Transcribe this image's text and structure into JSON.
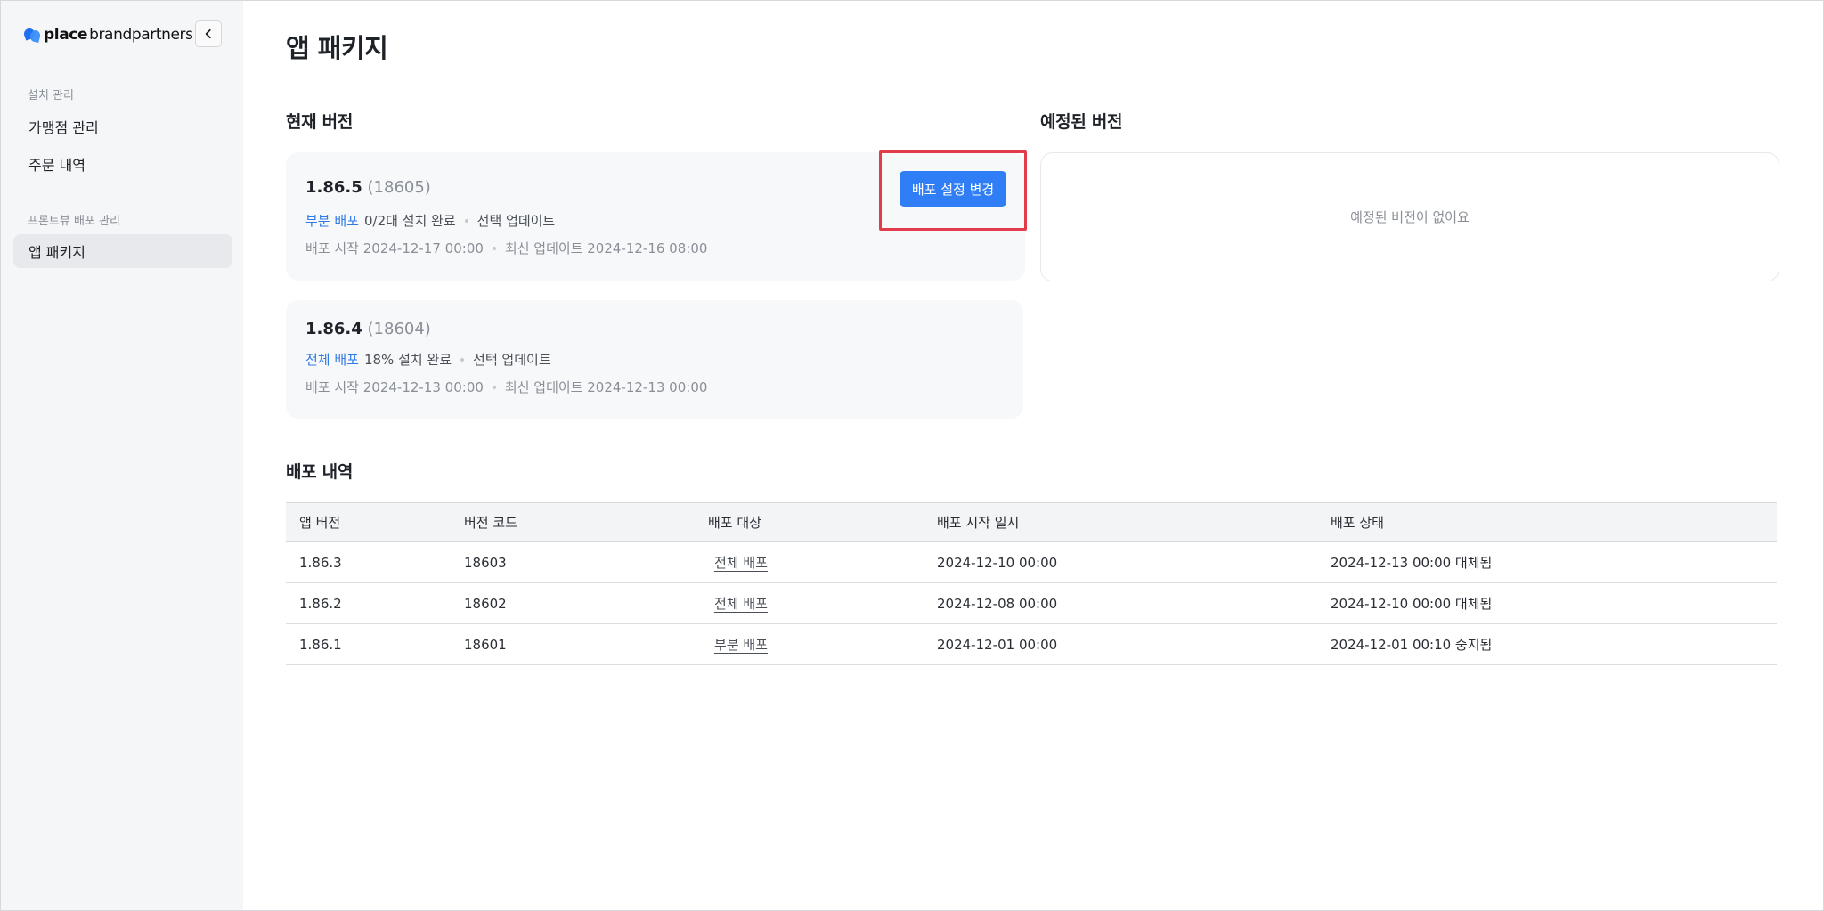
{
  "sidebar": {
    "logo": {
      "bold": "place",
      "rest": "brandpartners"
    },
    "sections": [
      {
        "label": "설치 관리",
        "items": [
          "가맹점 관리",
          "주문 내역"
        ]
      },
      {
        "label": "프론트뷰 배포 관리",
        "items": [
          "앱 패키지"
        ]
      }
    ],
    "active_item": "앱 패키지"
  },
  "page": {
    "title": "앱 패키지"
  },
  "current": {
    "title": "현재 버전",
    "cards": [
      {
        "version": "1.86.5",
        "code": "(18605)",
        "deploy_type": "부분 배포",
        "install_status": "0/2대 설치 완료",
        "update_type": "선택 업데이트",
        "start": "배포 시작 2024-12-17 00:00",
        "updated": "최신 업데이트 2024-12-16 08:00",
        "button_label": "배포 설정 변경"
      },
      {
        "version": "1.86.4",
        "code": "(18604)",
        "deploy_type": "전체 배포",
        "install_status": "18% 설치 완료",
        "update_type": "선택 업데이트",
        "start": "배포 시작 2024-12-13 00:00",
        "updated": "최신 업데이트 2024-12-13 00:00"
      }
    ]
  },
  "scheduled": {
    "title": "예정된 버전",
    "empty_text": "예정된 버전이 없어요"
  },
  "history": {
    "title": "배포 내역",
    "columns": [
      "앱 버전",
      "버전 코드",
      "배포 대상",
      "배포 시작 일시",
      "배포 상태"
    ],
    "rows": [
      [
        "1.86.3",
        "18603",
        "전체 배포",
        "2024-12-10 00:00",
        "2024-12-13 00:00 대체됨"
      ],
      [
        "1.86.2",
        "18602",
        "전체 배포",
        "2024-12-08 00:00",
        "2024-12-10 00:00 대체됨"
      ],
      [
        "1.86.1",
        "18601",
        "부분 배포",
        "2024-12-01 00:00",
        "2024-12-01 00:10 중지됨"
      ]
    ]
  },
  "colors": {
    "accent": "#2f7ef5",
    "link": "#2f7ae5",
    "highlight": "#e23b4a",
    "sidebar_bg": "#f5f6f8"
  }
}
